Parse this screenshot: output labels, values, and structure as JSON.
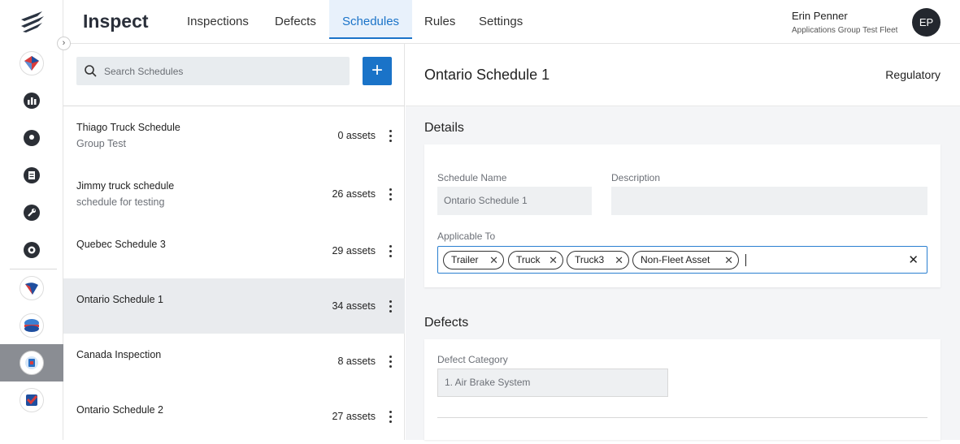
{
  "app": {
    "title": "Inspect"
  },
  "nav": {
    "tabs": [
      {
        "label": "Inspections"
      },
      {
        "label": "Defects"
      },
      {
        "label": "Schedules",
        "active": true
      },
      {
        "label": "Rules"
      },
      {
        "label": "Settings"
      }
    ]
  },
  "user": {
    "name": "Erin Penner",
    "fleet": "Applications Group Test Fleet",
    "initials": "EP"
  },
  "rail": {
    "icons": [
      "app-logo-icon",
      "analytics-app-icon",
      "dashboard-icon",
      "location-pin-icon",
      "document-icon",
      "wrench-icon",
      "settings-icon",
      "routing-app-icon",
      "transit-app-icon",
      "inspect-app-icon",
      "safety-app-icon"
    ]
  },
  "search": {
    "placeholder": "Search Schedules",
    "add_label": "+"
  },
  "schedules": [
    {
      "name": "Thiago Truck Schedule",
      "description": "Group Test",
      "assets": "0 assets"
    },
    {
      "name": "Jimmy truck schedule",
      "description": "schedule for testing",
      "assets": "26 assets"
    },
    {
      "name": "Quebec Schedule 3",
      "description": "",
      "assets": "29 assets"
    },
    {
      "name": "Ontario Schedule 1",
      "description": "",
      "assets": "34 assets",
      "selected": true
    },
    {
      "name": "Canada Inspection",
      "description": "",
      "assets": "8 assets"
    },
    {
      "name": "Ontario Schedule 2",
      "description": "",
      "assets": "27 assets"
    }
  ],
  "detail": {
    "title": "Ontario Schedule 1",
    "type": "Regulatory",
    "details_heading": "Details",
    "schedule_name_label": "Schedule Name",
    "schedule_name_value": "Ontario Schedule 1",
    "description_label": "Description",
    "description_value": "",
    "applicable_label": "Applicable To",
    "applicable_chips": [
      "Trailer",
      "Truck",
      "Truck3",
      "Non-Fleet Asset"
    ],
    "defects_heading": "Defects",
    "defect_category_label": "Defect Category",
    "defect_category_value": "1. Air Brake System"
  },
  "colors": {
    "accent": "#1a73c8",
    "selected_row": "#e9ebee",
    "avatar": "#23272e"
  }
}
